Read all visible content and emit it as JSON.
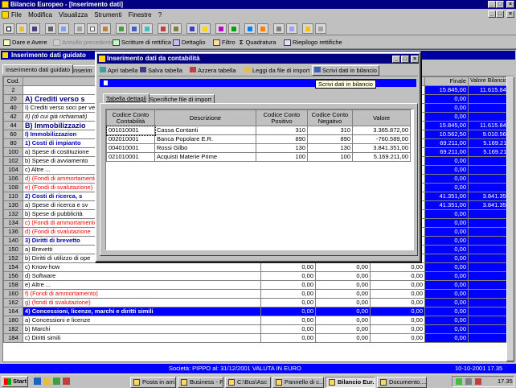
{
  "app": {
    "title": "Bilancio Europeo - [Inserimento dati]"
  },
  "menu": [
    "File",
    "Modifica",
    "Visualizza",
    "Strumenti",
    "Finestre",
    "?"
  ],
  "toolbar2": {
    "dare_avere": "Dare e Avere",
    "annullo": "Annullo precedente",
    "scritture": "Scritture di rettifica",
    "dettaglio": "Dettaglio",
    "filtro": "Filtro",
    "quadratura": "Quadratura",
    "riepilogo": "Riepilogo rettifiche"
  },
  "inner": {
    "title": "Inserimento dati guidato",
    "tabs": [
      "Inserimento dati guidato",
      "Inserim"
    ],
    "cod_header": "Cod.",
    "col_finale": "Finale",
    "col_valore_euro": "Valore Bilancio Euro"
  },
  "rows": [
    {
      "cod": "2",
      "desc": "Stato p",
      "type": "big",
      "c1": "",
      "c2": "",
      "c3": "",
      "r1": "15.845,00",
      "r2": "11.615.845"
    },
    {
      "cod": "20",
      "desc": "A) Crediti verso s",
      "type": "section",
      "c1": "",
      "c2": "",
      "c3": "",
      "r1": "0,00",
      "r2": "0"
    },
    {
      "cod": "40",
      "desc": "I) Crediti verso soci per vers",
      "type": "plain",
      "c1": "",
      "c2": "",
      "c3": "",
      "r1": "0,00",
      "r2": "0"
    },
    {
      "cod": "42",
      "desc": "II) (di cui già richiamati)",
      "type": "italic",
      "c1": "",
      "c2": "",
      "c3": "",
      "r1": "0,00",
      "r2": "0"
    },
    {
      "cod": "44",
      "desc": "B) Immobilizzazio",
      "type": "section",
      "c1": "",
      "c2": "",
      "c3": "",
      "r1": "15.845,00",
      "r2": "11.615.845"
    },
    {
      "cod": "60",
      "desc": "I) Immobilizzazion",
      "type": "blue",
      "c1": "",
      "c2": "",
      "c3": "",
      "r1": "10.562,50",
      "r2": "9.010.562"
    },
    {
      "cod": "80",
      "desc": "1) Costi di impianto",
      "type": "blue",
      "c1": "",
      "c2": "",
      "c3": "",
      "r1": "69.211,00",
      "r2": "5.169.211"
    },
    {
      "cod": "100",
      "desc": "a) Spese di costituzione",
      "type": "plain",
      "c1": "",
      "c2": "",
      "c3": "",
      "r1": "69.211,00",
      "r2": "5.169.211"
    },
    {
      "cod": "102",
      "desc": "b) Spese di avviamento",
      "type": "plain",
      "c1": "",
      "c2": "",
      "c3": "",
      "r1": "0,00",
      "r2": "0"
    },
    {
      "cod": "104",
      "desc": "c) Altre ...",
      "type": "plain",
      "c1": "",
      "c2": "",
      "c3": "",
      "r1": "0,00",
      "r2": "0"
    },
    {
      "cod": "106",
      "desc": "d) (Fondi di ammortamento",
      "type": "red",
      "c1": "",
      "c2": "",
      "c3": "",
      "r1": "0,00",
      "r2": "0"
    },
    {
      "cod": "108",
      "desc": "e) (Fondi di svalutazione)",
      "type": "red",
      "c1": "",
      "c2": "",
      "c3": "",
      "r1": "0,00",
      "r2": "0"
    },
    {
      "cod": "110",
      "desc": "2) Costi di ricerca, s",
      "type": "blue",
      "c1": "",
      "c2": "",
      "c3": "",
      "r1": "41.351,00",
      "r2": "3.841.351"
    },
    {
      "cod": "130",
      "desc": "a) Spese di ricerca e sv",
      "type": "plain",
      "c1": "",
      "c2": "",
      "c3": "",
      "r1": "41.351,00",
      "r2": "3.841.351"
    },
    {
      "cod": "132",
      "desc": "b) Spese di pubblicità",
      "type": "plain",
      "c1": "",
      "c2": "",
      "c3": "",
      "r1": "0,00",
      "r2": "0"
    },
    {
      "cod": "134",
      "desc": "c) (Fondi di ammortamento",
      "type": "red",
      "c1": "",
      "c2": "",
      "c3": "",
      "r1": "0,00",
      "r2": "0"
    },
    {
      "cod": "136",
      "desc": "d) (Fondi di svalutazione",
      "type": "red",
      "c1": "",
      "c2": "",
      "c3": "",
      "r1": "0,00",
      "r2": "0"
    },
    {
      "cod": "140",
      "desc": "3) Diritti di brevetto",
      "type": "blue",
      "c1": "",
      "c2": "",
      "c3": "",
      "r1": "0,00",
      "r2": "0"
    },
    {
      "cod": "150",
      "desc": "a) Brevetti",
      "type": "plain",
      "c1": "",
      "c2": "",
      "c3": "",
      "r1": "0,00",
      "r2": "0"
    },
    {
      "cod": "152",
      "desc": "b) Diritti di utilizzo di ope",
      "type": "plain",
      "c1": "",
      "c2": "",
      "c3": "",
      "r1": "0,00",
      "r2": "0"
    },
    {
      "cod": "154",
      "desc": "c) Know-how",
      "type": "plain",
      "c1": "0,00",
      "c2": "0,00",
      "c3": "0,00",
      "r1": "0,00",
      "r2": "0"
    },
    {
      "cod": "156",
      "desc": "d) Software",
      "type": "plain",
      "c1": "0,00",
      "c2": "0,00",
      "c3": "0,00",
      "r1": "0,00",
      "r2": "0"
    },
    {
      "cod": "158",
      "desc": "e) Altre ...",
      "type": "plain",
      "c1": "0,00",
      "c2": "0,00",
      "c3": "0,00",
      "r1": "0,00",
      "r2": "0"
    },
    {
      "cod": "160",
      "desc": "f) (Fondi di ammortamento)",
      "type": "red",
      "c1": "0,00",
      "c2": "0,00",
      "c3": "0,00",
      "r1": "0,00",
      "r2": "0"
    },
    {
      "cod": "162",
      "desc": "g) (fondi di svalutazione)",
      "type": "red",
      "c1": "0,00",
      "c2": "0,00",
      "c3": "0,00",
      "r1": "0,00",
      "r2": "0"
    },
    {
      "cod": "164",
      "desc": "4) Concessioni, licenze, marchi e diritti simili",
      "type": "bluesel",
      "c1": "0,00",
      "c2": "0,00",
      "c3": "0,00",
      "r1": "0,00",
      "r2": "0"
    },
    {
      "cod": "180",
      "desc": "a) Concessioni e licenze",
      "type": "plain",
      "c1": "0,00",
      "c2": "0,00",
      "c3": "0,00",
      "r1": "0,00",
      "r2": "0"
    },
    {
      "cod": "182",
      "desc": "b) Marchi",
      "type": "plain",
      "c1": "0,00",
      "c2": "0,00",
      "c3": "0,00",
      "r1": "0,00",
      "r2": "0"
    },
    {
      "cod": "184",
      "desc": "c) Diritti simili",
      "type": "plain",
      "c1": "0,00",
      "c2": "0,00",
      "c3": "0,00",
      "r1": "0,00",
      "r2": "0"
    }
  ],
  "dialog": {
    "title": "Inserimento dati da contabilità",
    "toolbar": [
      "Apri tabella",
      "Salva tabella",
      "Azzera tabella",
      "Leggi da file di import",
      "Scrivi dati in bilancio"
    ],
    "tooltip": "Scrivi dati in bilancio",
    "tabs": [
      "Tabella dettagli",
      "Specifiche file di import"
    ],
    "headers": [
      "Codice Conto Contabilità",
      "Descrizione",
      "Codice Conto Positivo",
      "Codice Conto Negativo",
      "Valore"
    ],
    "rows": [
      [
        "001010001",
        "Cassa Contanti",
        "310",
        "310",
        "3.365.872,00"
      ],
      [
        "002010001",
        "Banca Popolare E.R.",
        "890",
        "890",
        "-760.589,00"
      ],
      [
        "004010001",
        "Rossi Gilbo",
        "130",
        "130",
        "3.841.351,00"
      ],
      [
        "021010001",
        "Acquisti Materie Prime",
        "100",
        "100",
        "5.169.211,00"
      ]
    ]
  },
  "status": "Società: PIPPO al: 31/12/2001 VALUTA IN EURO",
  "status_right": "10-10-2001 17.35",
  "taskbar": {
    "start": "Start",
    "items": [
      "Posta in arri...",
      "Business - P...",
      "C:\\Bus\\Asc",
      "Pannello di c...",
      "Bilancio Eur...",
      "Documento...."
    ],
    "clock": "17.35"
  }
}
